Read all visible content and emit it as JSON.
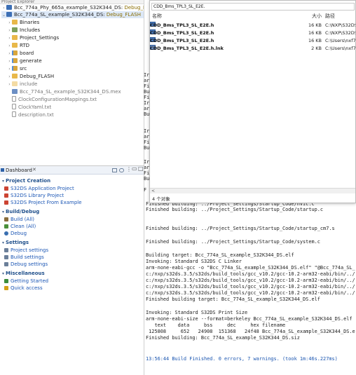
{
  "explorer": {
    "header_fragment": "Project Explorer",
    "rows": [
      {
        "label": "Bcc_774a_Phy_665a_example_S32K344_DS:",
        "decoration": "Debug_FLASH",
        "level": 0
      },
      {
        "label": "Bcc_774a_SL_example_S32K344_DS:",
        "decoration": "Debug_FLASH",
        "level": 0
      },
      {
        "label": "Binaries",
        "level": 1
      },
      {
        "label": "Includes",
        "level": 1
      },
      {
        "label": "Project_Settings",
        "level": 1
      },
      {
        "label": "RTD",
        "level": 1
      },
      {
        "label": "board",
        "level": 1
      },
      {
        "label": "generate",
        "level": 1
      },
      {
        "label": "src",
        "level": 1
      },
      {
        "label": "Debug_FLASH",
        "level": 1
      },
      {
        "label": "include",
        "level": 1
      },
      {
        "label": "Bcc_774a_SL_example_S32K344_DS.mex",
        "level": 1
      },
      {
        "label": "ClockConfigurationMappings.txt",
        "level": 1
      },
      {
        "label": "ClockYaml.txt",
        "level": 1
      },
      {
        "label": "description.txt",
        "level": 1
      }
    ]
  },
  "dashboard": {
    "title": "Dashboard",
    "sections": [
      {
        "title": "Project Creation",
        "links": [
          "S32DS Application Project",
          "S32DS Library Project",
          "S32DS Project From Example"
        ]
      },
      {
        "title": "Build/Debug",
        "links": [
          "Build  (All)",
          "Clean  (All)",
          "Debug"
        ]
      },
      {
        "title": "Settings",
        "links": [
          "Project settings",
          "Build settings",
          "Debug settings"
        ]
      },
      {
        "title": "Miscellaneous",
        "links": [
          "Getting Started",
          "Quick access"
        ]
      }
    ]
  },
  "console": {
    "left_fragments": [
      "Ir",
      "ar",
      "Fi",
      "Bu",
      "Fi",
      "Ir",
      "ar",
      "Bu",
      "",
      "Ir",
      "ar",
      "Fi",
      "Bu",
      "",
      "Ir",
      "ar",
      "Fi",
      "Bu",
      "",
      "F"
    ],
    "lines": [
      "Finished building: ../Project_Settings/Startup_Code/nvic.c",
      "Finished building: ../Project_Settings/Startup_Code/startup.c",
      "",
      "",
      "Finished building: ../Project_Settings/Startup_Code/startup_cm7.s",
      "",
      "Finished building: ../Project_Settings/Startup_Code/system.c",
      "",
      "Building target: Bcc_774a_SL_example_S32K344_DS.elf",
      "Invoking: Standard S32DS C Linker",
      "arm-none-eabi-gcc -o \"Bcc_774a_SL_example_S32K344_DS.elf\" \"@Bcc_774a_SL_",
      "c:/nxp/s32ds.3.5/s32ds/build_tools/gcc_v10.2/gcc-10.2-arm32-eabi/bin/../",
      "c:/nxp/s32ds.3.5/s32ds/build_tools/gcc_v10.2/gcc-10.2-arm32-eabi/bin/../",
      "c:/nxp/s32ds.3.5/s32ds/build_tools/gcc_v10.2/gcc-10.2-arm32-eabi/bin/../",
      "c:/nxp/s32ds.3.5/s32ds/build_tools/gcc_v10.2/gcc-10.2-arm32-eabi/bin/../",
      "Finished building target: Bcc_774a_SL_example_S32K344_DS.elf",
      "",
      "Invoking: Standard S32DS Print Size",
      "arm-none-eabi-size --format=berkeley Bcc_774a_SL_example_S32K344_DS.elf",
      "   text    data     bss     dec     hex filename",
      " 125808     652   24908  151368   24f48 Bcc_774a_SL_example_S32K344_DS.e",
      "Finished building: Bcc_774a_SL_example_S32K344_DS.siz",
      "",
      "",
      "13:56:44 Build Finished. 0 errors, 7 warnings. (took 1m:46s.227ms)"
    ]
  },
  "dialog": {
    "address": "CDD_Bms_TPL3_SL_E2E.",
    "columns": {
      "name": "名称",
      "size": "大小",
      "path": "路径"
    },
    "files": [
      {
        "name": "CDD_Bms_TPL3_SL_E2E.h",
        "size": "16 KB",
        "path": "C:\\NXP\\S32DS"
      },
      {
        "name": "CDD_Bms_TPL3_SL_E2E.h",
        "size": "16 KB",
        "path": "C:\\NXP\\S32DS"
      },
      {
        "name": "CDD_Bms_TPL3_SL_E2E.h",
        "size": "16 KB",
        "path": "C:\\Users\\nxf74"
      },
      {
        "name": "CDD_Bms_TPL3_SL_E2E.h.lnk",
        "size": "2 KB",
        "path": "C:\\Users\\nxf74"
      }
    ],
    "status": "4 个对象"
  }
}
